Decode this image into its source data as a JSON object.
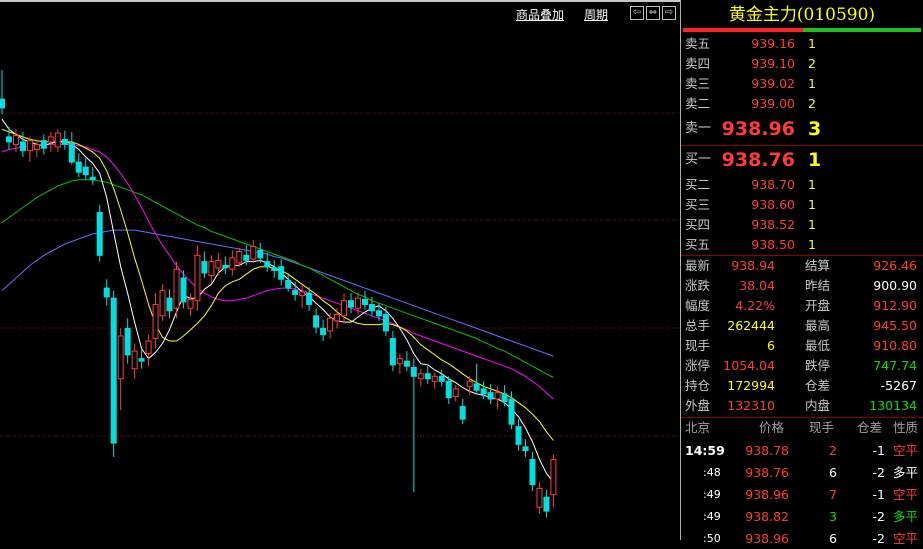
{
  "toolbar": {
    "overlay_label": "商品叠加",
    "period_label": "周期",
    "nav_left": "⇦",
    "nav_both": "⇔",
    "nav_right": "⇨"
  },
  "panel": {
    "title": "黄金主力(010590)",
    "asks": [
      {
        "label": "卖五",
        "price": "939.16",
        "vol": "1"
      },
      {
        "label": "卖四",
        "price": "939.10",
        "vol": "2"
      },
      {
        "label": "卖三",
        "price": "939.02",
        "vol": "1"
      },
      {
        "label": "卖二",
        "price": "939.00",
        "vol": "2"
      },
      {
        "label": "卖一",
        "price": "938.96",
        "vol": "3"
      }
    ],
    "bids": [
      {
        "label": "买一",
        "price": "938.76",
        "vol": "1"
      },
      {
        "label": "买二",
        "price": "938.70",
        "vol": "1"
      },
      {
        "label": "买三",
        "price": "938.60",
        "vol": "1"
      },
      {
        "label": "买四",
        "price": "938.52",
        "vol": "1"
      },
      {
        "label": "买五",
        "price": "938.50",
        "vol": "1"
      }
    ],
    "quote": [
      {
        "l1": "最新",
        "v1": "938.94",
        "l2": "结算",
        "v2": "926.46"
      },
      {
        "l1": "涨跌",
        "v1": "38.04",
        "l2": "昨结",
        "v2": "900.90"
      },
      {
        "l1": "幅度",
        "v1": "4.22%",
        "l2": "开盘",
        "v2": "912.90"
      },
      {
        "l1": "总手",
        "v1": "262444",
        "l2": "最高",
        "v2": "945.50"
      },
      {
        "l1": "现手",
        "v1": "6",
        "l2": "最低",
        "v2": "910.80"
      },
      {
        "l1": "涨停",
        "v1": "1054.04",
        "l2": "跌停",
        "v2": "747.74"
      },
      {
        "l1": "持仓",
        "v1": "172994",
        "l2": "仓差",
        "v2": "-5267"
      },
      {
        "l1": "外盘",
        "v1": "132310",
        "l2": "内盘",
        "v2": "130134"
      }
    ],
    "ticks_header": {
      "time": "北京",
      "price": "价格",
      "vol": "现手",
      "oi": "仓差",
      "nature": "性质"
    },
    "ticks": [
      {
        "time": "14:59",
        "price": "938.78",
        "vol": "2",
        "oi": "-1",
        "nature": "空平"
      },
      {
        "time": ":48",
        "price": "938.76",
        "vol": "6",
        "oi": "-2",
        "nature": "多平"
      },
      {
        "time": ":49",
        "price": "938.96",
        "vol": "7",
        "oi": "-1",
        "nature": "空平"
      },
      {
        "time": ":49",
        "price": "938.82",
        "vol": "3",
        "oi": "-2",
        "nature": "多平"
      },
      {
        "time": ":50",
        "price": "938.96",
        "vol": "6",
        "oi": "-2",
        "nature": "空平"
      }
    ]
  },
  "colors": {
    "up": "#ff3a3a",
    "down": "#00e0e0",
    "ma5": "#ffffff",
    "ma10": "#ffff00",
    "ma20": "#ff00ff",
    "ma40": "#00c000",
    "ma60": "#6a6aff"
  },
  "chart_data": {
    "type": "candlestick",
    "title": "",
    "xlabel": "",
    "ylabel": "",
    "ylim": [
      908,
      948
    ],
    "candles": [
      {
        "o": 942.2,
        "h": 944.5,
        "l": 941.0,
        "c": 941.5
      },
      {
        "o": 939.2,
        "h": 940.0,
        "l": 938.2,
        "c": 938.8
      },
      {
        "o": 938.6,
        "h": 939.8,
        "l": 938.0,
        "c": 939.3
      },
      {
        "o": 938.8,
        "h": 939.6,
        "l": 937.6,
        "c": 938.1
      },
      {
        "o": 938.1,
        "h": 939.2,
        "l": 937.2,
        "c": 938.9
      },
      {
        "o": 938.2,
        "h": 939.0,
        "l": 937.6,
        "c": 938.6
      },
      {
        "o": 938.9,
        "h": 939.4,
        "l": 937.8,
        "c": 938.3
      },
      {
        "o": 938.8,
        "h": 939.6,
        "l": 938.0,
        "c": 939.2
      },
      {
        "o": 938.4,
        "h": 939.8,
        "l": 938.0,
        "c": 939.5
      },
      {
        "o": 939.0,
        "h": 939.7,
        "l": 938.2,
        "c": 938.6
      },
      {
        "o": 938.7,
        "h": 939.6,
        "l": 937.0,
        "c": 937.2
      },
      {
        "o": 937.2,
        "h": 937.9,
        "l": 936.0,
        "c": 936.4
      },
      {
        "o": 936.8,
        "h": 937.5,
        "l": 935.8,
        "c": 936.2
      },
      {
        "o": 936.0,
        "h": 936.8,
        "l": 935.4,
        "c": 935.8
      },
      {
        "o": 933.2,
        "h": 933.8,
        "l": 929.3,
        "c": 929.8
      },
      {
        "o": 927.2,
        "h": 927.9,
        "l": 925.8,
        "c": 926.5
      },
      {
        "o": 926.4,
        "h": 927.0,
        "l": 913.8,
        "c": 914.9
      },
      {
        "o": 920.0,
        "h": 924.0,
        "l": 917.5,
        "c": 923.4
      },
      {
        "o": 924.0,
        "h": 924.8,
        "l": 921.2,
        "c": 921.9
      },
      {
        "o": 920.8,
        "h": 922.8,
        "l": 920.0,
        "c": 922.2
      },
      {
        "o": 921.6,
        "h": 922.3,
        "l": 920.8,
        "c": 921.4
      },
      {
        "o": 922.0,
        "h": 923.5,
        "l": 921.0,
        "c": 923.0
      },
      {
        "o": 923.2,
        "h": 926.8,
        "l": 922.4,
        "c": 925.9
      },
      {
        "o": 925.0,
        "h": 927.5,
        "l": 924.6,
        "c": 927.0
      },
      {
        "o": 926.4,
        "h": 927.1,
        "l": 924.8,
        "c": 925.4
      },
      {
        "o": 925.6,
        "h": 929.3,
        "l": 924.8,
        "c": 928.7
      },
      {
        "o": 928.0,
        "h": 928.6,
        "l": 925.6,
        "c": 926.1
      },
      {
        "o": 925.6,
        "h": 926.8,
        "l": 925.0,
        "c": 926.3
      },
      {
        "o": 926.2,
        "h": 930.6,
        "l": 925.4,
        "c": 929.8
      },
      {
        "o": 929.3,
        "h": 930.1,
        "l": 928.0,
        "c": 928.4
      },
      {
        "o": 928.2,
        "h": 929.8,
        "l": 927.6,
        "c": 929.3
      },
      {
        "o": 928.8,
        "h": 930.0,
        "l": 928.2,
        "c": 929.4
      },
      {
        "o": 929.0,
        "h": 929.7,
        "l": 928.3,
        "c": 928.8
      },
      {
        "o": 928.7,
        "h": 930.2,
        "l": 928.2,
        "c": 929.6
      },
      {
        "o": 929.2,
        "h": 930.4,
        "l": 928.9,
        "c": 930.1
      },
      {
        "o": 929.8,
        "h": 930.6,
        "l": 929.0,
        "c": 929.4
      },
      {
        "o": 929.5,
        "h": 931.0,
        "l": 929.2,
        "c": 930.5
      },
      {
        "o": 930.2,
        "h": 930.8,
        "l": 929.2,
        "c": 929.6
      },
      {
        "o": 929.3,
        "h": 930.0,
        "l": 928.5,
        "c": 928.9
      },
      {
        "o": 928.8,
        "h": 929.4,
        "l": 928.0,
        "c": 928.6
      },
      {
        "o": 928.9,
        "h": 929.5,
        "l": 927.4,
        "c": 927.9
      },
      {
        "o": 927.8,
        "h": 928.4,
        "l": 926.9,
        "c": 927.2
      },
      {
        "o": 927.0,
        "h": 927.7,
        "l": 926.2,
        "c": 926.7
      },
      {
        "o": 926.6,
        "h": 927.4,
        "l": 925.6,
        "c": 926.9
      },
      {
        "o": 926.8,
        "h": 927.3,
        "l": 925.4,
        "c": 925.9
      },
      {
        "o": 925.0,
        "h": 925.6,
        "l": 923.6,
        "c": 924.1
      },
      {
        "o": 924.0,
        "h": 924.7,
        "l": 923.0,
        "c": 923.5
      },
      {
        "o": 923.8,
        "h": 925.2,
        "l": 923.2,
        "c": 924.8
      },
      {
        "o": 924.6,
        "h": 925.6,
        "l": 924.0,
        "c": 925.1
      },
      {
        "o": 925.0,
        "h": 926.8,
        "l": 924.4,
        "c": 926.2
      },
      {
        "o": 926.2,
        "h": 926.8,
        "l": 925.2,
        "c": 925.7
      },
      {
        "o": 925.6,
        "h": 926.9,
        "l": 925.1,
        "c": 926.4
      },
      {
        "o": 926.3,
        "h": 927.0,
        "l": 925.5,
        "c": 925.9
      },
      {
        "o": 925.9,
        "h": 926.5,
        "l": 925.0,
        "c": 925.4
      },
      {
        "o": 925.4,
        "h": 926.0,
        "l": 924.6,
        "c": 925.0
      },
      {
        "o": 925.1,
        "h": 925.7,
        "l": 923.4,
        "c": 923.8
      },
      {
        "o": 923.2,
        "h": 923.8,
        "l": 920.6,
        "c": 921.1
      },
      {
        "o": 921.2,
        "h": 922.0,
        "l": 920.4,
        "c": 921.6
      },
      {
        "o": 921.4,
        "h": 922.2,
        "l": 920.6,
        "c": 921.0
      },
      {
        "o": 920.9,
        "h": 921.6,
        "l": 911.0,
        "c": 920.2
      },
      {
        "o": 920.0,
        "h": 920.8,
        "l": 919.4,
        "c": 920.4
      },
      {
        "o": 920.4,
        "h": 921.0,
        "l": 919.6,
        "c": 920.0
      },
      {
        "o": 919.8,
        "h": 920.5,
        "l": 919.2,
        "c": 920.2
      },
      {
        "o": 920.2,
        "h": 920.7,
        "l": 919.4,
        "c": 919.8
      },
      {
        "o": 919.8,
        "h": 920.2,
        "l": 918.0,
        "c": 918.5
      },
      {
        "o": 918.6,
        "h": 919.5,
        "l": 918.2,
        "c": 919.2
      },
      {
        "o": 917.8,
        "h": 918.4,
        "l": 916.4,
        "c": 916.8
      },
      {
        "o": 919.4,
        "h": 920.2,
        "l": 918.7,
        "c": 919.8
      },
      {
        "o": 919.6,
        "h": 921.2,
        "l": 918.9,
        "c": 919.1
      },
      {
        "o": 919.2,
        "h": 919.8,
        "l": 918.4,
        "c": 918.8
      },
      {
        "o": 918.9,
        "h": 919.6,
        "l": 918.0,
        "c": 918.4
      },
      {
        "o": 918.4,
        "h": 919.4,
        "l": 917.6,
        "c": 918.9
      },
      {
        "o": 918.8,
        "h": 919.5,
        "l": 917.8,
        "c": 918.2
      },
      {
        "o": 918.4,
        "h": 919.0,
        "l": 916.0,
        "c": 916.4
      },
      {
        "o": 916.2,
        "h": 916.8,
        "l": 914.3,
        "c": 914.8
      },
      {
        "o": 914.6,
        "h": 915.2,
        "l": 913.8,
        "c": 914.3
      },
      {
        "o": 913.6,
        "h": 914.2,
        "l": 911.1,
        "c": 911.6
      },
      {
        "o": 909.8,
        "h": 911.8,
        "l": 909.3,
        "c": 911.3
      },
      {
        "o": 910.6,
        "h": 911.2,
        "l": 909.0,
        "c": 909.5
      },
      {
        "o": 910.8,
        "h": 914.0,
        "l": 909.8,
        "c": 913.6
      }
    ],
    "ma5": [
      940.6,
      939.8,
      939.4,
      939.0,
      938.8,
      938.6,
      938.5,
      938.7,
      938.8,
      938.9,
      938.6,
      938.2,
      937.6,
      937.1,
      936.3,
      934.4,
      931.6,
      928.9,
      926.8,
      924.5,
      922.4,
      921.6,
      922.1,
      922.8,
      923.9,
      925.3,
      926.6,
      926.4,
      926.4,
      927.1,
      927.5,
      928.4,
      928.9,
      929.0,
      929.0,
      929.3,
      929.3,
      929.4,
      929.2,
      928.9,
      928.4,
      927.9,
      927.4,
      926.9,
      926.5,
      926.0,
      925.5,
      924.9,
      924.6,
      924.5,
      924.5,
      924.9,
      925.3,
      925.6,
      925.8,
      925.4,
      924.8,
      924.0,
      923.1,
      922.0,
      921.2,
      921.1,
      920.7,
      920.4,
      920.0,
      919.7,
      919.3,
      919.0,
      918.8,
      918.7,
      918.5,
      918.4,
      918.1,
      917.6,
      917.0,
      916.1,
      915.0,
      913.6,
      912.5,
      911.8
    ],
    "ma10": [
      939.8,
      939.6,
      939.4,
      939.2,
      939.0,
      938.9,
      938.8,
      938.8,
      938.8,
      938.8,
      938.8,
      938.6,
      938.3,
      938.0,
      937.5,
      936.5,
      935.1,
      933.4,
      931.6,
      929.6,
      927.8,
      925.9,
      924.3,
      923.3,
      923.0,
      923.0,
      923.4,
      923.9,
      924.4,
      925.0,
      925.8,
      926.8,
      927.4,
      927.7,
      927.9,
      928.3,
      928.7,
      928.9,
      928.9,
      928.8,
      928.6,
      928.3,
      927.9,
      927.5,
      927.1,
      926.7,
      926.2,
      925.8,
      925.3,
      924.9,
      924.6,
      924.4,
      924.3,
      924.3,
      924.3,
      924.4,
      924.3,
      924.1,
      923.8,
      923.3,
      922.7,
      922.3,
      921.9,
      921.5,
      921.2,
      920.8,
      920.4,
      920.0,
      919.7,
      919.4,
      919.2,
      919.0,
      918.8,
      918.5,
      918.1,
      917.7,
      917.2,
      916.6,
      915.8,
      915.1
    ],
    "ma20": [
      938.0,
      938.2,
      938.3,
      938.4,
      938.5,
      938.5,
      938.6,
      938.6,
      938.6,
      938.6,
      938.6,
      938.5,
      938.4,
      938.2,
      938.0,
      937.6,
      937.0,
      936.3,
      935.5,
      934.6,
      933.6,
      932.5,
      931.5,
      930.6,
      929.8,
      929.0,
      928.3,
      927.7,
      927.2,
      926.8,
      926.5,
      926.3,
      926.2,
      926.2,
      926.3,
      926.4,
      926.6,
      926.8,
      927.0,
      927.1,
      927.2,
      927.2,
      927.1,
      927.0,
      926.8,
      926.6,
      926.4,
      926.2,
      926.0,
      925.8,
      925.6,
      925.4,
      925.2,
      925.0,
      924.8,
      924.6,
      924.4,
      924.1,
      923.9,
      923.6,
      923.4,
      923.2,
      923.0,
      922.8,
      922.6,
      922.4,
      922.2,
      922.0,
      921.8,
      921.6,
      921.4,
      921.2,
      921.0,
      920.8,
      920.5,
      920.2,
      919.8,
      919.4,
      918.9,
      918.4
    ],
    "ma40": [
      932.4,
      932.8,
      933.2,
      933.6,
      934.0,
      934.4,
      934.7,
      935.0,
      935.3,
      935.5,
      935.7,
      935.8,
      935.8,
      935.8,
      935.7,
      935.6,
      935.4,
      935.2,
      935.0,
      934.8,
      934.6,
      934.3,
      934.0,
      933.7,
      933.4,
      933.1,
      932.8,
      932.5,
      932.2,
      932.0,
      931.7,
      931.5,
      931.3,
      931.1,
      930.9,
      930.7,
      930.5,
      930.3,
      930.1,
      929.9,
      929.7,
      929.5,
      929.3,
      929.0,
      928.8,
      928.5,
      928.2,
      927.9,
      927.6,
      927.3,
      927.0,
      926.7,
      926.5,
      926.2,
      926.0,
      925.8,
      925.6,
      925.4,
      925.2,
      925.0,
      924.8,
      924.6,
      924.4,
      924.2,
      924.0,
      923.8,
      923.6,
      923.4,
      923.2,
      922.9,
      922.7,
      922.4,
      922.2,
      921.9,
      921.6,
      921.3,
      921.0,
      920.7,
      920.4,
      920.1
    ],
    "ma60": [
      927.0,
      927.5,
      928.0,
      928.5,
      929.0,
      929.4,
      929.8,
      930.1,
      930.4,
      930.7,
      930.9,
      931.1,
      931.3,
      931.5,
      931.6,
      931.7,
      931.8,
      931.8,
      931.8,
      931.8,
      931.7,
      931.6,
      931.5,
      931.4,
      931.3,
      931.2,
      931.1,
      931.0,
      930.9,
      930.8,
      930.7,
      930.6,
      930.5,
      930.4,
      930.3,
      930.2,
      930.1,
      930.0,
      929.9,
      929.7,
      929.6,
      929.4,
      929.2,
      929.0,
      928.8,
      928.6,
      928.4,
      928.2,
      928.0,
      927.8,
      927.6,
      927.4,
      927.2,
      927.0,
      926.8,
      926.6,
      926.4,
      926.2,
      926.0,
      925.8,
      925.6,
      925.4,
      925.2,
      925.0,
      924.8,
      924.6,
      924.4,
      924.2,
      924.0,
      923.8,
      923.6,
      923.4,
      923.2,
      923.0,
      922.8,
      922.6,
      922.4,
      922.2,
      922.0,
      921.8
    ]
  }
}
